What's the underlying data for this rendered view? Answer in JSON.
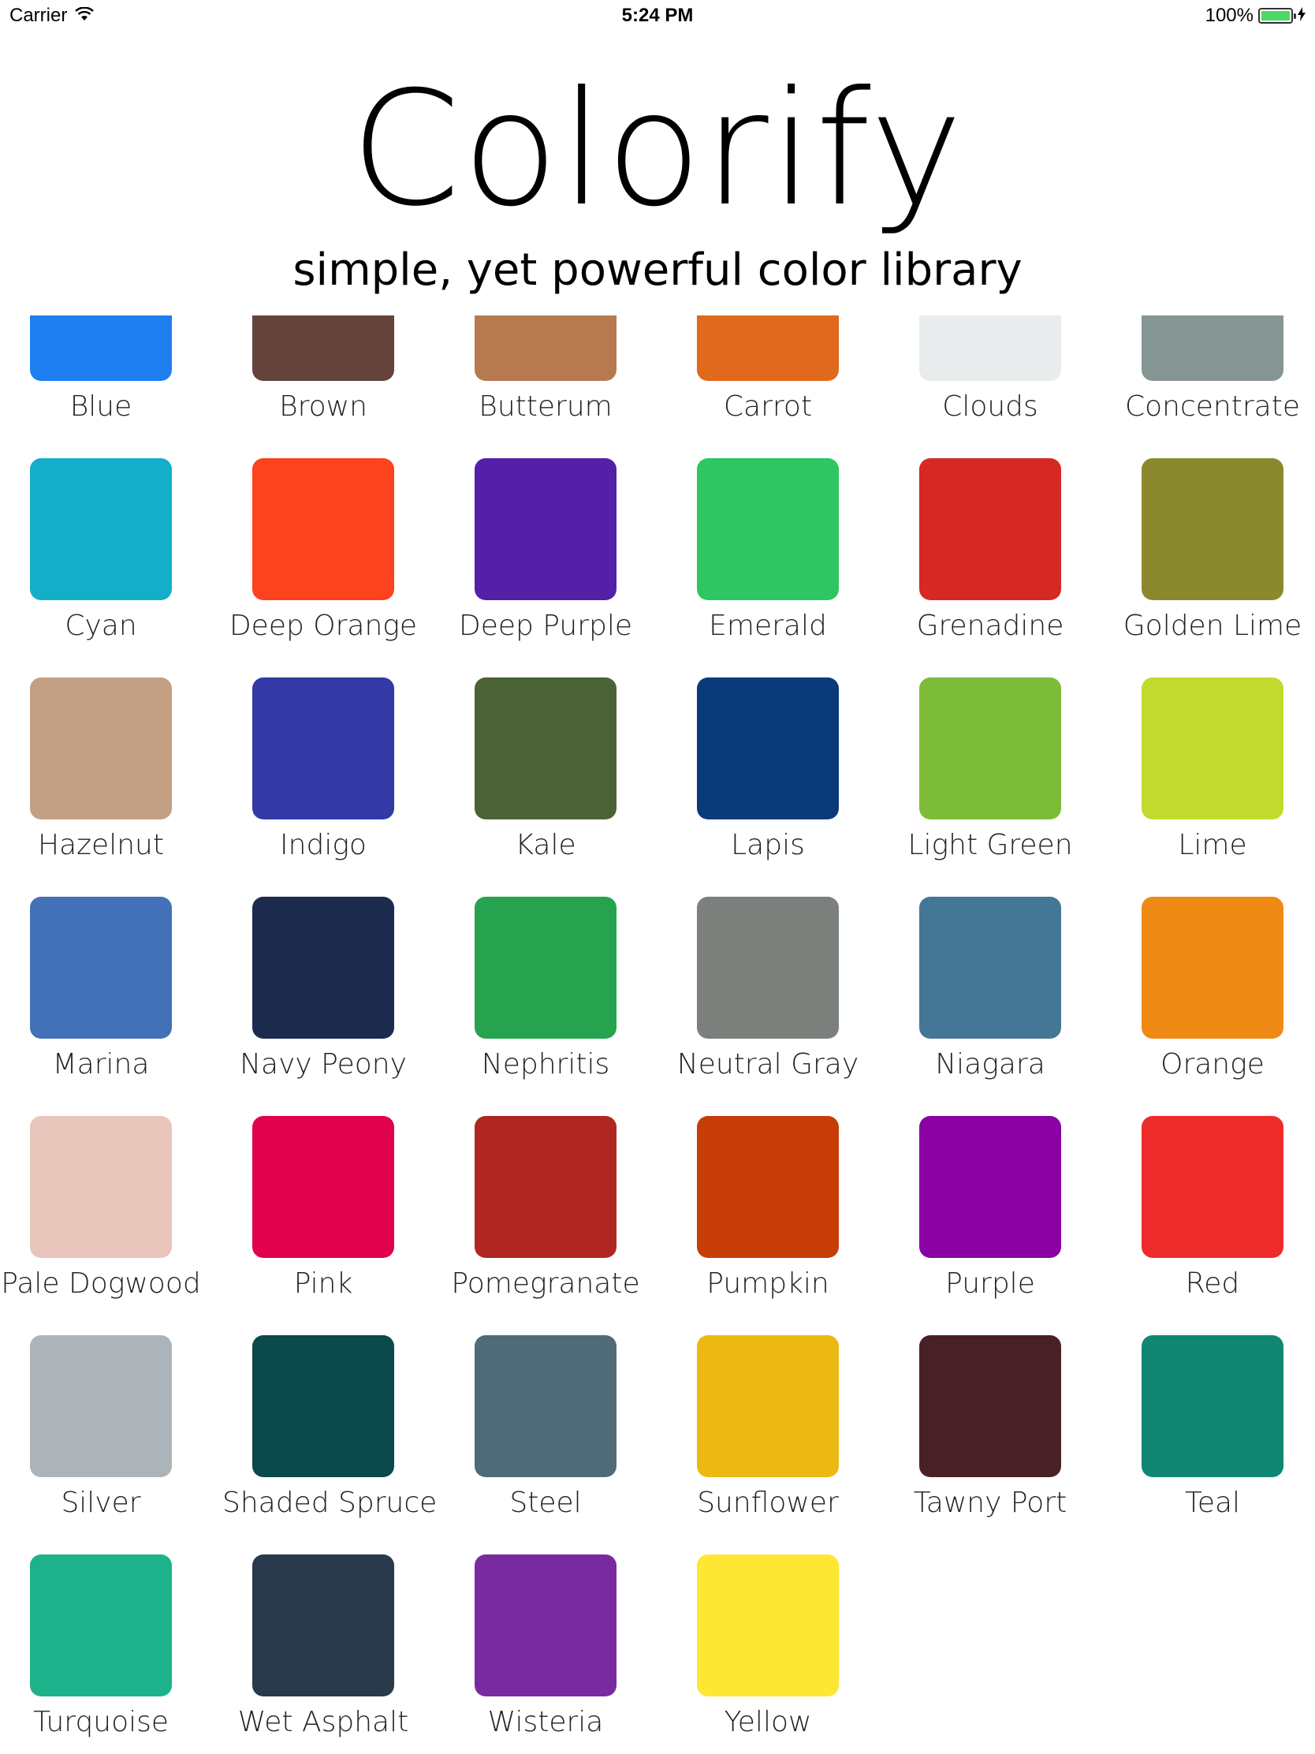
{
  "status": {
    "carrier": "Carrier",
    "time": "5:24 PM",
    "battery": "100%",
    "battery_color": "#4cd964"
  },
  "header": {
    "title": "Colorify",
    "subtitle": "simple, yet powerful color library"
  },
  "colors": [
    {
      "name": "Blue",
      "hex": "#1f7ff0"
    },
    {
      "name": "Brown",
      "hex": "#63433a"
    },
    {
      "name": "Butterum",
      "hex": "#b77a50"
    },
    {
      "name": "Carrot",
      "hex": "#e0691d"
    },
    {
      "name": "Clouds",
      "hex": "#e8ecec"
    },
    {
      "name": "Concentrate",
      "hex": "#859594"
    },
    {
      "name": "Cyan",
      "hex": "#14aecb"
    },
    {
      "name": "Deep Orange",
      "hex": "#fd421e"
    },
    {
      "name": "Deep Purple",
      "hex": "#5520a8"
    },
    {
      "name": "Emerald",
      "hex": "#2dc663"
    },
    {
      "name": "Grenadine",
      "hex": "#d62926"
    },
    {
      "name": "Golden Lime",
      "hex": "#8b892e"
    },
    {
      "name": "Hazelnut",
      "hex": "#c3a083"
    },
    {
      "name": "Indigo",
      "hex": "#333aa6"
    },
    {
      "name": "Kale",
      "hex": "#4a6236"
    },
    {
      "name": "Lapis",
      "hex": "#0b3a7a"
    },
    {
      "name": "Light Green",
      "hex": "#7dbc38"
    },
    {
      "name": "Lime",
      "hex": "#c1da2d"
    },
    {
      "name": "Marina",
      "hex": "#4271b8"
    },
    {
      "name": "Navy Peony",
      "hex": "#1c2b4d"
    },
    {
      "name": "Nephritis",
      "hex": "#25a34e"
    },
    {
      "name": "Neutral Gray",
      "hex": "#7c807c"
    },
    {
      "name": "Niagara",
      "hex": "#447696"
    },
    {
      "name": "Orange",
      "hex": "#ef8a15"
    },
    {
      "name": "Pale Dogwood",
      "hex": "#e8c6bb"
    },
    {
      "name": "Pink",
      "hex": "#e0024c"
    },
    {
      "name": "Pomegranate",
      "hex": "#b02621"
    },
    {
      "name": "Pumpkin",
      "hex": "#c63d08"
    },
    {
      "name": "Purple",
      "hex": "#8a02a4"
    },
    {
      "name": "Red",
      "hex": "#ee2b2b"
    },
    {
      "name": "Silver",
      "hex": "#adb4b9"
    },
    {
      "name": "Shaded Spruce",
      "hex": "#0b494a"
    },
    {
      "name": "Steel",
      "hex": "#4f6b78"
    },
    {
      "name": "Sunflower",
      "hex": "#ecb912"
    },
    {
      "name": "Tawny Port",
      "hex": "#482127"
    },
    {
      "name": "Teal",
      "hex": "#108771"
    },
    {
      "name": "Turquoise",
      "hex": "#1eb28b"
    },
    {
      "name": "Wet Asphalt",
      "hex": "#283a4b"
    },
    {
      "name": "Wisteria",
      "hex": "#7a2aa1"
    },
    {
      "name": "Yellow",
      "hex": "#fee733"
    }
  ]
}
